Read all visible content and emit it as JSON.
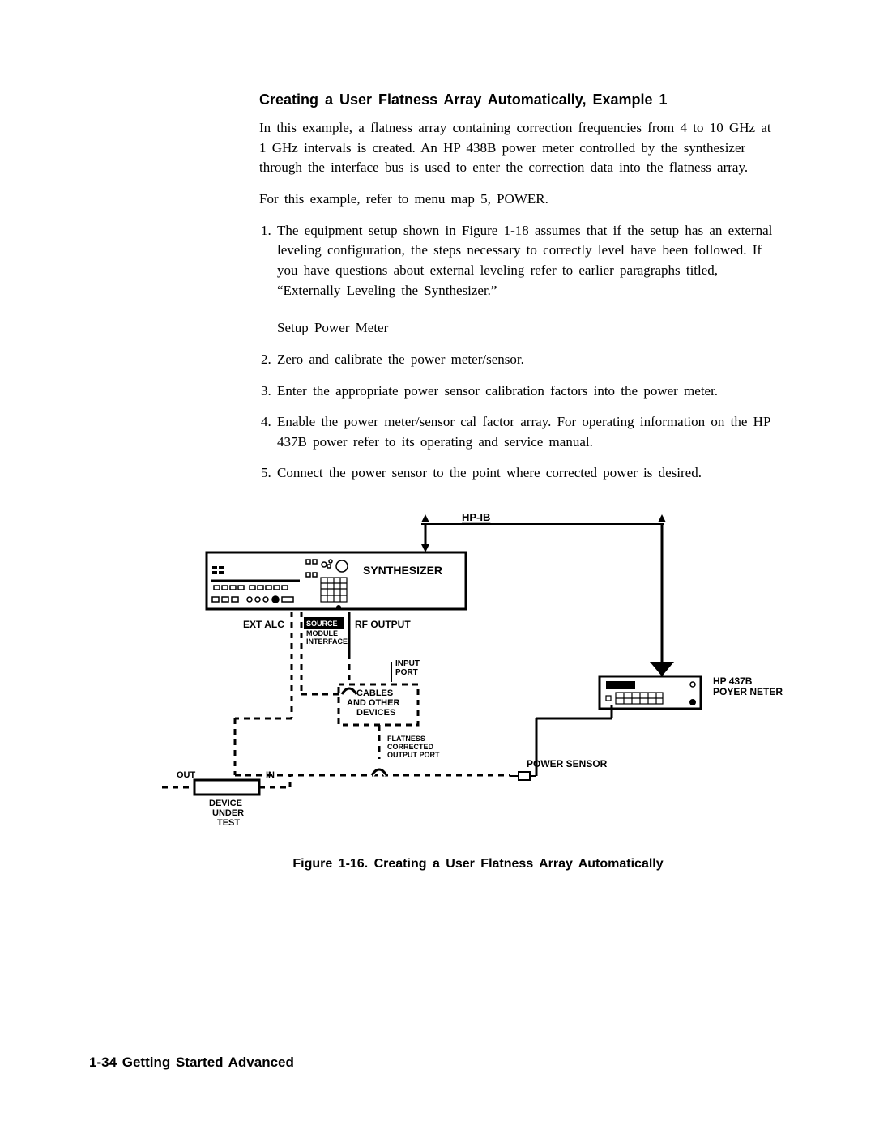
{
  "heading": "Creating a User Flatness Array Automatically, Example 1",
  "para1": "In this example, a flatness array containing correction frequencies from 4 to 10 GHz at 1 GHz intervals is created. An HP 438B power meter controlled by the synthesizer through the interface bus is used to enter the correction data into the flatness array.",
  "para2": "For this example, refer to menu map 5, POWER.",
  "steps": {
    "s1": "The equipment setup shown in Figure 1-18 assumes that if the setup has an external leveling configuration, the steps necessary to correctly level have been followed. If you have questions about external leveling refer to earlier paragraphs titled, “Externally Leveling the Synthesizer.”",
    "setup_label": "Setup Power Meter",
    "s2": "Zero and calibrate the power meter/sensor.",
    "s3": "Enter the appropriate power sensor calibration factors into the power meter.",
    "s4": "Enable the power meter/sensor cal factor array. For operating information on the HP 437B power refer to its operating and service manual.",
    "s5": "Connect the power sensor to the point where corrected power is desired."
  },
  "figure": {
    "hp_ib": "HP-IB",
    "synthesizer": "SYNTHESIZER",
    "ext_alc": "EXT ALC",
    "source_module_interface_l1": "SOURCE",
    "source_module_interface_l2": "MODULE",
    "source_module_interface_l3": "INTERFACE",
    "rf_output": "RF OUTPUT",
    "input_port_l1": "INPUT",
    "input_port_l2": "PORT",
    "cables_l1": "CABLES",
    "cables_l2": "AND OTHER",
    "cables_l3": "DEVICES",
    "flatness_l1": "FLATNESS",
    "flatness_l2": "CORRECTED",
    "flatness_l3": "OUTPUT PORT",
    "power_sensor": "POWER SENSOR",
    "out": "OUT",
    "in": "IN",
    "device_l1": "DEVICE",
    "device_l2": "UNDER",
    "device_l3": "TEST",
    "hp_437b_l1": "HP 437B",
    "hp_437b_l2": "POYER NETER",
    "caption": "Figure 1-16. Creating a User Flatness Array Automatically"
  },
  "footer": "1-34 Getting Started Advanced"
}
